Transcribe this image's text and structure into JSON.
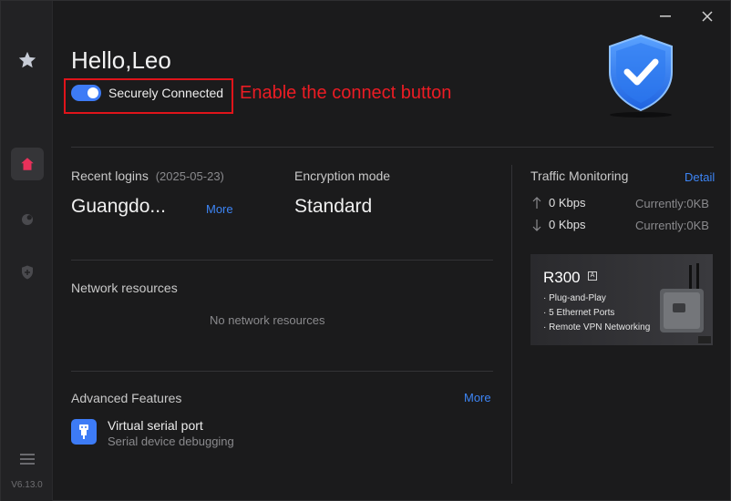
{
  "sidebar": {
    "version": "V6.13.0"
  },
  "header": {
    "greeting": "Hello,Leo",
    "toggle_label": "Securely Connected",
    "annotation": "Enable the connect button"
  },
  "recent_logins": {
    "title": "Recent logins",
    "date": "(2025-05-23)",
    "location": "Guangdo...",
    "more": "More"
  },
  "encryption": {
    "title": "Encryption mode",
    "value": "Standard"
  },
  "traffic": {
    "title": "Traffic Monitoring",
    "detail": "Detail",
    "upload": "0 Kbps",
    "upload_current": "Currently:0KB",
    "download": "0 Kbps",
    "download_current": "Currently:0KB"
  },
  "network": {
    "title": "Network resources",
    "empty": "No network resources"
  },
  "advanced": {
    "title": "Advanced Features",
    "more": "More",
    "feature_name": "Virtual serial port",
    "feature_desc": "Serial device debugging"
  },
  "ad": {
    "title": "R300",
    "badge": "A",
    "items": [
      "· Plug-and-Play",
      "· 5 Ethernet Ports",
      "· Remote VPN Networking"
    ]
  },
  "colors": {
    "accent": "#3d7bf6",
    "highlight": "#e0141a",
    "active_icon": "#e8315a"
  }
}
